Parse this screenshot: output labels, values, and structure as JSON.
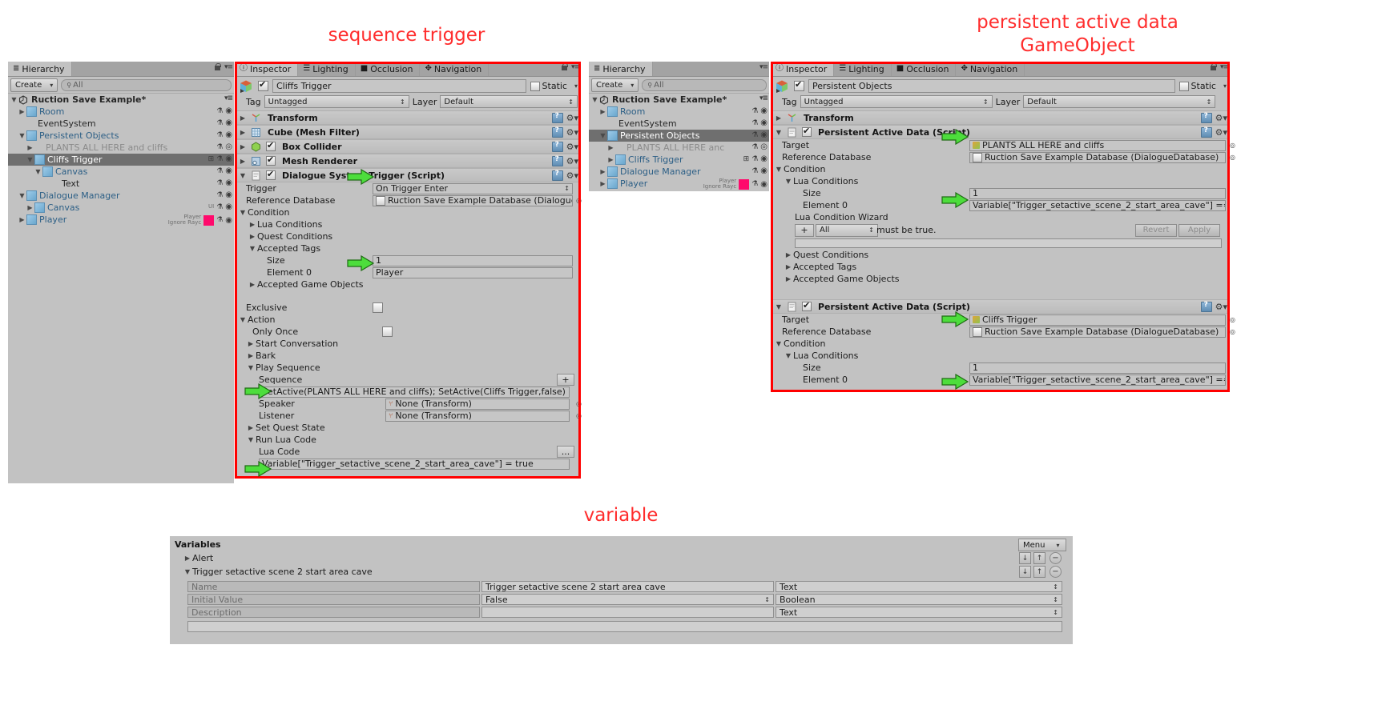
{
  "annotations": {
    "sequence_trigger": "sequence trigger",
    "persistent_active_data": "persistent active data\nGameObject",
    "variable": "variable"
  },
  "hierarchy_left": {
    "tab_label": "Hierarchy",
    "create_label": "Create",
    "search_placeholder": "All",
    "scene_label": "Ruction Save Example*",
    "items": [
      {
        "label": "Room",
        "indent": 1,
        "arrow": "▶",
        "prefab": true,
        "selected": false,
        "dim": false
      },
      {
        "label": "EventSystem",
        "indent": 1,
        "arrow": "",
        "prefab": false,
        "selected": false,
        "dim": false
      },
      {
        "label": "Persistent Objects",
        "indent": 1,
        "arrow": "▼",
        "prefab": true,
        "selected": false,
        "dim": false
      },
      {
        "label": "PLANTS ALL HERE and cliffs",
        "indent": 2,
        "arrow": "▶",
        "prefab": false,
        "selected": false,
        "dim": true
      },
      {
        "label": "Cliffs Trigger",
        "indent": 2,
        "arrow": "▼",
        "prefab": true,
        "selected": true,
        "dim": false,
        "grid": true
      },
      {
        "label": "Canvas",
        "indent": 3,
        "arrow": "▼",
        "prefab": true,
        "selected": false,
        "dim": false
      },
      {
        "label": "Text",
        "indent": 4,
        "arrow": "",
        "prefab": false,
        "selected": false,
        "dim": false
      },
      {
        "label": "Dialogue Manager",
        "indent": 1,
        "arrow": "▼",
        "prefab": true,
        "selected": false,
        "dim": false
      },
      {
        "label": "Canvas",
        "indent": 2,
        "arrow": "▶",
        "prefab": true,
        "selected": false,
        "dim": false,
        "tag": "UI"
      },
      {
        "label": "Player",
        "indent": 1,
        "arrow": "▶",
        "prefab": true,
        "selected": false,
        "dim": false,
        "tag": "Player",
        "tag2": "Ignore Rayc",
        "swatch": "#ff0a6c"
      }
    ]
  },
  "hierarchy_right": {
    "tab_label": "Hierarchy",
    "create_label": "Create",
    "search_placeholder": "All",
    "scene_label": "Ruction Save Example*",
    "items": [
      {
        "label": "Room",
        "indent": 1,
        "arrow": "▶",
        "prefab": true,
        "selected": false,
        "dim": false
      },
      {
        "label": "EventSystem",
        "indent": 1,
        "arrow": "",
        "prefab": false,
        "selected": false,
        "dim": false
      },
      {
        "label": "Persistent Objects",
        "indent": 1,
        "arrow": "▼",
        "prefab": true,
        "selected": true,
        "dim": false
      },
      {
        "label": "PLANTS ALL HERE anc",
        "indent": 2,
        "arrow": "▶",
        "prefab": false,
        "selected": false,
        "dim": true
      },
      {
        "label": "Cliffs Trigger",
        "indent": 2,
        "arrow": "▶",
        "prefab": true,
        "selected": false,
        "dim": false,
        "grid": true
      },
      {
        "label": "Dialogue Manager",
        "indent": 1,
        "arrow": "▶",
        "prefab": true,
        "selected": false,
        "dim": false
      },
      {
        "label": "Player",
        "indent": 1,
        "arrow": "▶",
        "prefab": true,
        "selected": false,
        "dim": false,
        "tag": "Player",
        "tag2": "Ignore Rayc",
        "swatch": "#ff0a6c"
      }
    ]
  },
  "inspector_left": {
    "tabs": [
      "Inspector",
      "Lighting",
      "Occlusion",
      "Navigation"
    ],
    "active_tab": "Inspector",
    "object_name": "Cliffs Trigger",
    "object_enabled": true,
    "static_label": "Static",
    "tag_label": "Tag",
    "tag_value": "Untagged",
    "layer_label": "Layer",
    "layer_value": "Default",
    "components": [
      {
        "name": "Transform",
        "icon": "transform",
        "expanded": false,
        "checkbox": null
      },
      {
        "name": "Cube (Mesh Filter)",
        "icon": "meshfilter",
        "expanded": false,
        "checkbox": null
      },
      {
        "name": "Box Collider",
        "icon": "collider",
        "expanded": false,
        "checkbox": true
      },
      {
        "name": "Mesh Renderer",
        "icon": "renderer",
        "expanded": false,
        "checkbox": true
      },
      {
        "name": "Dialogue System Trigger (Script)",
        "icon": "script",
        "expanded": true,
        "checkbox": true
      }
    ],
    "trigger_label": "Trigger",
    "trigger_value": "On Trigger Enter",
    "reference_database_label": "Reference Database",
    "reference_database_value": "Ruction Save Example Database (DialogueD",
    "condition_label": "Condition",
    "lua_conditions_label": "Lua Conditions",
    "quest_conditions_label": "Quest Conditions",
    "accepted_tags_label": "Accepted Tags",
    "size_label": "Size",
    "size_value": "1",
    "element0_label": "Element 0",
    "element0_value": "Player",
    "accepted_game_objects_label": "Accepted Game Objects",
    "exclusive_label": "Exclusive",
    "exclusive_value": false,
    "action_label": "Action",
    "only_once_label": "Only Once",
    "only_once_value": false,
    "start_conversation_label": "Start Conversation",
    "bark_label": "Bark",
    "play_sequence_label": "Play Sequence",
    "sequence_label": "Sequence",
    "sequence_plus": "+",
    "sequence_value": "SetActive(PLANTS ALL HERE and cliffs); SetActive(Cliffs Trigger,false)",
    "speaker_label": "Speaker",
    "speaker_value": "None (Transform)",
    "listener_label": "Listener",
    "listener_value": "None (Transform)",
    "set_quest_state_label": "Set Quest State",
    "run_lua_code_label": "Run Lua Code",
    "lua_code_label": "Lua Code",
    "lua_code_more": "...",
    "lua_code_value": "Variable[\"Trigger_setactive_scene_2_start_area_cave\"] = true"
  },
  "inspector_right": {
    "tabs": [
      "Inspector",
      "Lighting",
      "Occlusion",
      "Navigation"
    ],
    "active_tab": "Inspector",
    "object_name": "Persistent Objects",
    "object_enabled": true,
    "static_label": "Static",
    "tag_label": "Tag",
    "tag_value": "Untagged",
    "layer_label": "Layer",
    "layer_value": "Default",
    "transform_label": "Transform",
    "scripts": [
      {
        "name": "Persistent Active Data (Script)",
        "checkbox": true,
        "target_label": "Target",
        "target_value": "PLANTS ALL HERE and cliffs",
        "reference_database_label": "Reference Database",
        "reference_database_value": "Ruction Save Example Database (DialogueDatabase)",
        "condition_label": "Condition",
        "lua_conditions_label": "Lua Conditions",
        "size_label": "Size",
        "size_value": "1",
        "element0_label": "Element 0",
        "element0_value": "Variable[\"Trigger_setactive_scene_2_start_area_cave\"] == true",
        "wizard_label": "Lua Condition Wizard",
        "wizard_plus": "+",
        "wizard_mode": "All",
        "wizard_text": "must be true.",
        "revert_label": "Revert",
        "apply_label": "Apply",
        "quest_conditions_label": "Quest Conditions",
        "accepted_tags_label": "Accepted Tags",
        "accepted_game_objects_label": "Accepted Game Objects",
        "has_extra_folds": true
      },
      {
        "name": "Persistent Active Data (Script)",
        "checkbox": true,
        "target_label": "Target",
        "target_value": "Cliffs Trigger",
        "reference_database_label": "Reference Database",
        "reference_database_value": "Ruction Save Example Database (DialogueDatabase)",
        "condition_label": "Condition",
        "lua_conditions_label": "Lua Conditions",
        "size_label": "Size",
        "size_value": "1",
        "element0_label": "Element 0",
        "element0_value": "Variable[\"Trigger_setactive_scene_2_start_area_cave\"] == false",
        "has_extra_folds": false
      }
    ]
  },
  "variables_window": {
    "title": "Variables",
    "menu_label": "Menu",
    "rows": [
      {
        "label": "Alert",
        "arrow": "▶",
        "expanded": false
      },
      {
        "label": "Trigger setactive scene 2 start area cave",
        "arrow": "▼",
        "expanded": true
      }
    ],
    "fields": [
      {
        "label": "Name",
        "value": "Trigger setactive scene 2 start area cave",
        "type": "Text",
        "type_dropdown": false
      },
      {
        "label": "Initial Value",
        "value": "False",
        "type": "Boolean",
        "type_dropdown": true
      },
      {
        "label": "Description",
        "value": "",
        "type": "Text",
        "type_dropdown": false
      }
    ],
    "buttons": {
      "down": "↓",
      "up": "↑",
      "minus": "−",
      "down2": "↓",
      "up2": "↑",
      "minus2": "−"
    }
  },
  "colors": {
    "annotation_red": "#ff2d2d",
    "highlight_box": "#ff0000",
    "arrow_green": "#4ddd3c",
    "panel_bg": "#c2c2c2",
    "selection": "#6f6f6f",
    "player_swatch": "#ff0a6c"
  }
}
